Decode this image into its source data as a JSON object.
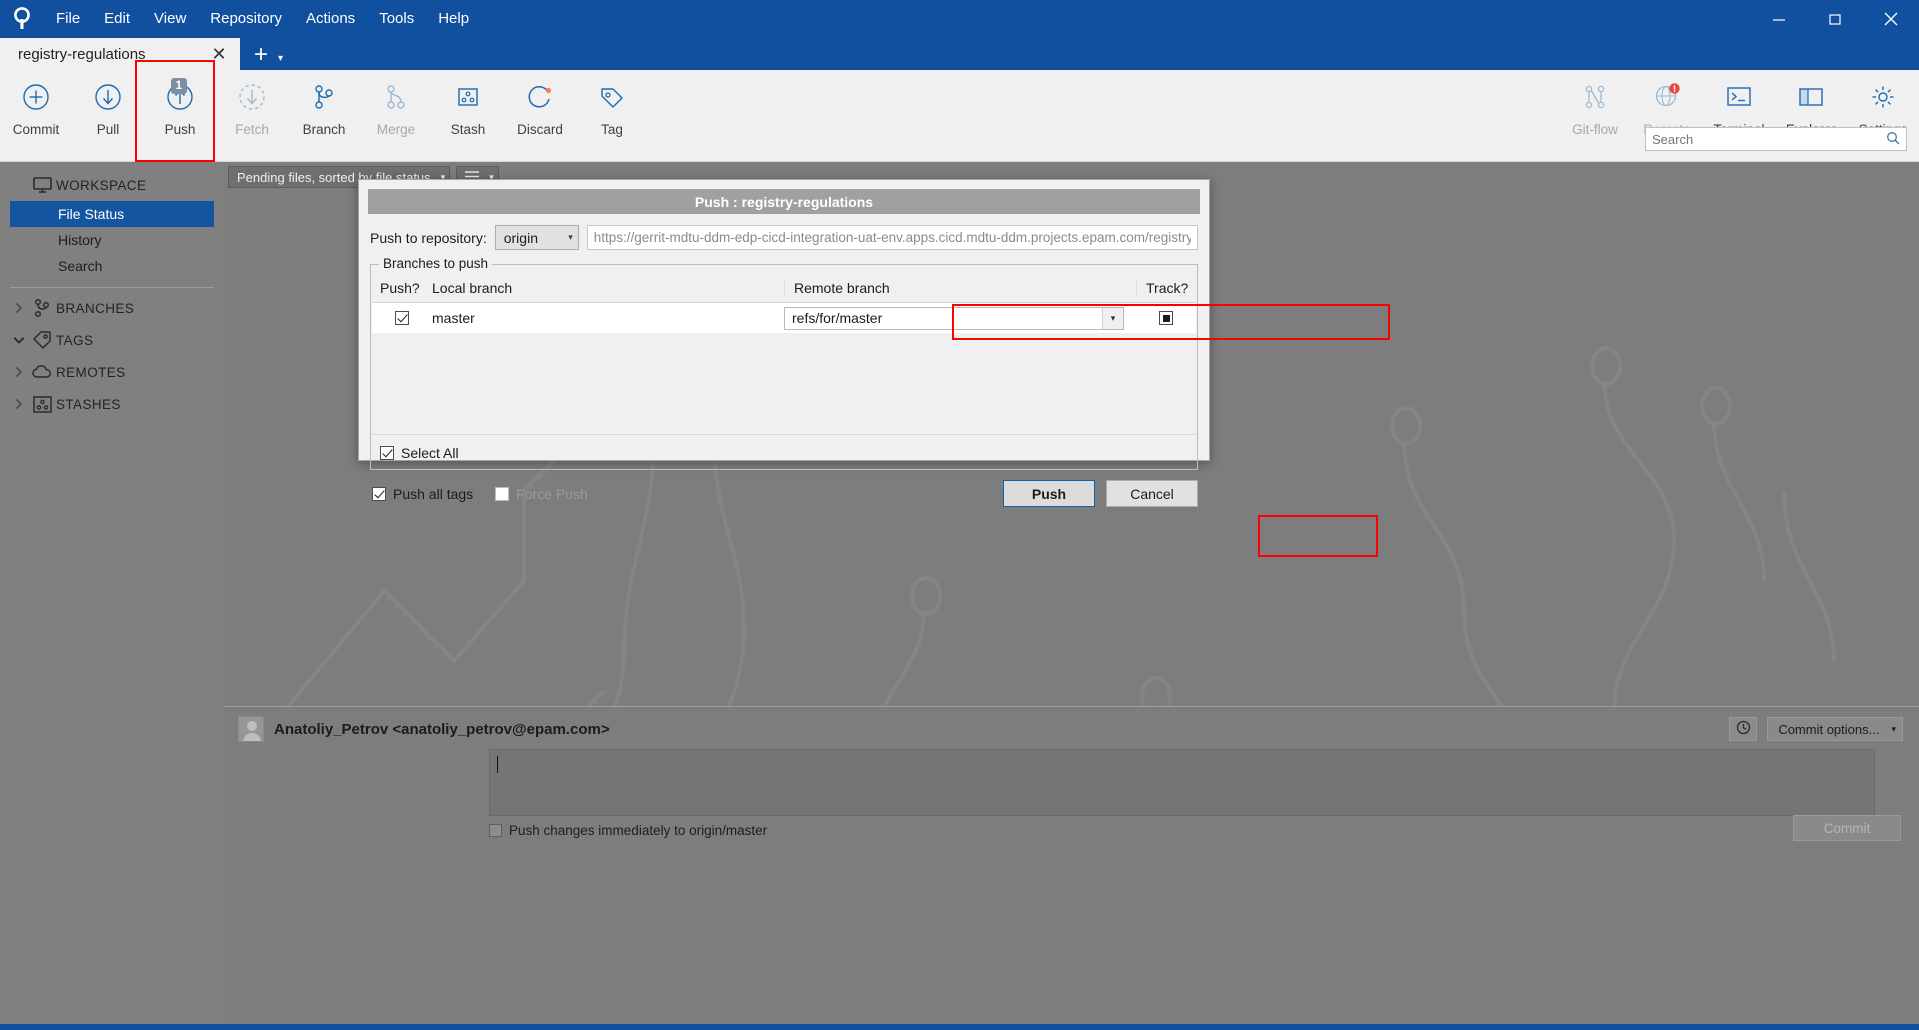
{
  "app": {
    "name": "SourceTree",
    "logo_icon": "sourcetree-logo-icon"
  },
  "menubar": {
    "items": [
      "File",
      "Edit",
      "View",
      "Repository",
      "Actions",
      "Tools",
      "Help"
    ]
  },
  "window_controls": {
    "minimize": "─",
    "maximize": "❐",
    "close": "✕"
  },
  "tabs": {
    "active_label": "registry-regulations",
    "close_glyph": "✕",
    "new_tab_glyph": "+",
    "dropdown_glyph": "▾"
  },
  "toolbar": {
    "left_buttons": [
      {
        "label": "Commit",
        "icon": "commit-plus-circle-icon",
        "badge": null,
        "disabled": false
      },
      {
        "label": "Pull",
        "icon": "pull-down-arrow-circle-icon",
        "badge": null,
        "disabled": false
      },
      {
        "label": "Push",
        "icon": "push-up-arrow-circle-icon",
        "badge": "1",
        "disabled": false
      },
      {
        "label": "Fetch",
        "icon": "fetch-dashed-circle-icon",
        "badge": null,
        "disabled": true
      },
      {
        "label": "Branch",
        "icon": "branch-icon",
        "badge": null,
        "disabled": false
      },
      {
        "label": "Merge",
        "icon": "merge-icon",
        "badge": null,
        "disabled": true
      },
      {
        "label": "Stash",
        "icon": "stash-box-icon",
        "badge": null,
        "disabled": false
      },
      {
        "label": "Discard",
        "icon": "discard-refresh-icon",
        "badge": null,
        "disabled": false
      },
      {
        "label": "Tag",
        "icon": "tag-icon",
        "badge": null,
        "disabled": false
      }
    ],
    "right_buttons": [
      {
        "label": "Git-flow",
        "icon": "gitflow-icon",
        "disabled": true
      },
      {
        "label": "Remote",
        "icon": "remote-globe-icon",
        "disabled": true
      },
      {
        "label": "Terminal",
        "icon": "terminal-icon",
        "disabled": false
      },
      {
        "label": "Explorer",
        "icon": "explorer-folder-icon",
        "disabled": false
      },
      {
        "label": "Settings",
        "icon": "gear-icon",
        "disabled": false
      }
    ]
  },
  "search": {
    "placeholder": "Search",
    "icon": "search-icon",
    "value": ""
  },
  "sidebar": {
    "workspace": {
      "label": "WORKSPACE",
      "icon": "monitor-icon"
    },
    "workspace_items": [
      {
        "label": "File Status",
        "active": true
      },
      {
        "label": "History",
        "active": false
      },
      {
        "label": "Search",
        "active": false
      }
    ],
    "sections": [
      {
        "label": "BRANCHES",
        "icon": "branch-icon",
        "expanded": false,
        "arrow": "❯"
      },
      {
        "label": "TAGS",
        "icon": "tag-icon",
        "expanded": true,
        "arrow": "❯"
      },
      {
        "label": "REMOTES",
        "icon": "cloud-icon",
        "expanded": false,
        "arrow": "❯"
      },
      {
        "label": "STASHES",
        "icon": "stash-box-icon",
        "expanded": false,
        "arrow": "❯"
      }
    ]
  },
  "main": {
    "file_filter": {
      "value": "Pending files, sorted by file status",
      "caret": "▾"
    },
    "view_mode": {
      "icon": "list-view-icon",
      "caret": "▾"
    }
  },
  "commit_panel": {
    "author": "Anatoliy_Petrov <anatoliy_petrov@epam.com>",
    "avatar_icon": "avatar-icon",
    "history_icon": "clock-icon",
    "commit_options_label": "Commit options...",
    "commit_options_caret": "▾",
    "message_value": "",
    "push_immediately_label": "Push changes immediately to origin/master",
    "push_immediately_checked": false,
    "commit_button_label": "Commit",
    "commit_button_disabled": true
  },
  "push_dialog": {
    "title": "Push :  registry-regulations",
    "repo_label": "Push to repository:",
    "repo_selected": "origin",
    "repo_caret": "▾",
    "repo_url": "https://gerrit-mdtu-ddm-edp-cicd-integration-uat-env.apps.cicd.mdtu-ddm.projects.epam.com/registry-regula",
    "group_legend": "Branches to push",
    "columns": [
      "Push?",
      "Local branch",
      "Remote branch",
      "Track?"
    ],
    "rows": [
      {
        "push_checked": true,
        "local_branch": "master",
        "remote_branch": "refs/for/master",
        "remote_caret": "▾",
        "track_checked": true
      }
    ],
    "select_all_label": "Select All",
    "select_all_checked": true,
    "push_all_tags_label": "Push all tags",
    "push_all_tags_checked": true,
    "force_push_label": "Force Push",
    "force_push_checked": false,
    "force_push_disabled": true,
    "push_button_label": "Push",
    "cancel_button_label": "Cancel"
  },
  "colors": {
    "brand_blue": "#11509f",
    "highlight_red": "#ff0000",
    "badge_grey": "#7e8fa3",
    "accent_orange": "#ff7a59"
  }
}
